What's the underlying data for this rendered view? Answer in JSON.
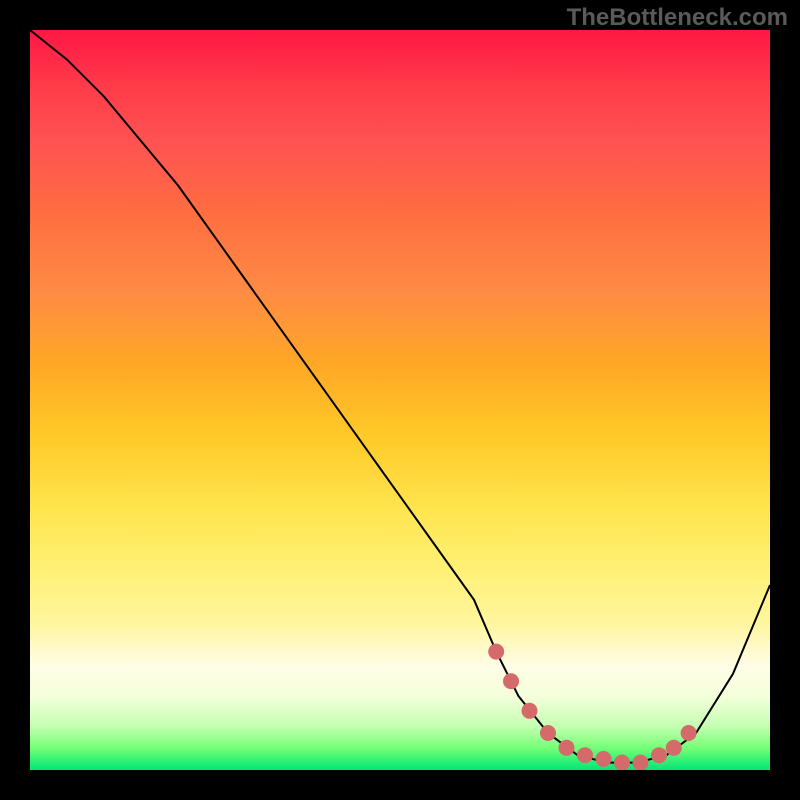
{
  "watermark": "TheBottleneck.com",
  "chart_data": {
    "type": "line",
    "title": "",
    "xlabel": "",
    "ylabel": "",
    "xlim": [
      0,
      100
    ],
    "ylim": [
      0,
      100
    ],
    "series": [
      {
        "name": "bottleneck-curve",
        "x": [
          0,
          5,
          10,
          15,
          20,
          25,
          30,
          35,
          40,
          45,
          50,
          55,
          60,
          63,
          66,
          70,
          74,
          78,
          82,
          86,
          90,
          95,
          100
        ],
        "values": [
          100,
          96,
          91,
          85,
          79,
          72,
          65,
          58,
          51,
          44,
          37,
          30,
          23,
          16,
          10,
          5,
          2,
          1,
          1,
          2,
          5,
          13,
          25
        ]
      }
    ],
    "highlight_dots": {
      "name": "optimal-range",
      "x": [
        63,
        65,
        67.5,
        70,
        72.5,
        75,
        77.5,
        80,
        82.5,
        85,
        87,
        89
      ],
      "values": [
        16,
        12,
        8,
        5,
        3,
        2,
        1.5,
        1,
        1,
        2,
        3,
        5
      ]
    },
    "background": "gradient-red-to-green"
  }
}
